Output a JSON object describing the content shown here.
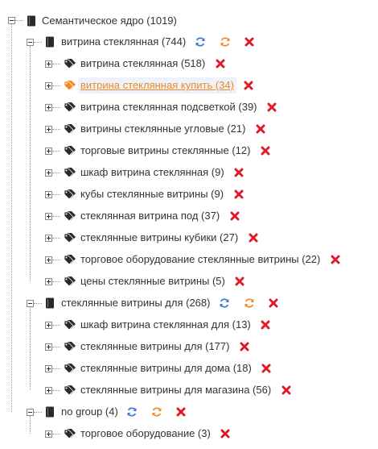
{
  "root": {
    "label": "Семантическое ядро (1019)"
  },
  "groups": [
    {
      "label": "витрина стеклянная (744)",
      "items": [
        {
          "label": "витрина стеклянная (518)"
        },
        {
          "label": "витрина стеклянная купить (34)",
          "active": true
        },
        {
          "label": "витрина стеклянная подсветкой (39)"
        },
        {
          "label": "витрины стеклянные угловые (21)"
        },
        {
          "label": "торговые витрины стеклянные (12)"
        },
        {
          "label": "шкаф витрина стеклянная (9)"
        },
        {
          "label": "кубы стеклянные витрины (9)"
        },
        {
          "label": "стеклянная витрина под (37)"
        },
        {
          "label": "стеклянные витрины кубики (27)"
        },
        {
          "label": "торговое оборудование стеклянные витрины (22)"
        },
        {
          "label": "цены стеклянные витрины (5)"
        }
      ]
    },
    {
      "label": "стеклянные витрины для (268)",
      "items": [
        {
          "label": "шкаф витрина стеклянная для (13)"
        },
        {
          "label": "стеклянные витрины для (177)"
        },
        {
          "label": "стеклянные витрины для дома (18)"
        },
        {
          "label": "стеклянные витрины для магазина (56)"
        }
      ]
    },
    {
      "label": "no group (4)",
      "items": [
        {
          "label": "торговое оборудование (3)"
        }
      ]
    }
  ],
  "colors": {
    "blue": "#3a7bd5",
    "orange": "#f08a24",
    "red": "#e0192a",
    "icon": "#2b2b2b"
  }
}
